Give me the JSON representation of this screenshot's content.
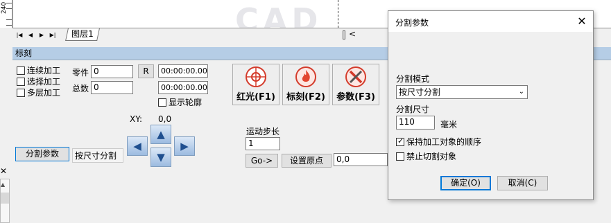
{
  "canvas": {
    "ruler_label": "240",
    "watermark": "CAD",
    "layer_tab": "图层1",
    "scroll_left_glyph": "<"
  },
  "tab_nav": [
    "|◀",
    "◀",
    "▶",
    "▶|"
  ],
  "left_edge": {
    "close_glyph": "✕"
  },
  "panel": {
    "title": "标刻",
    "continuous": {
      "label": "连续加工",
      "checked": false
    },
    "select_process": {
      "label": "选择加工",
      "checked": false
    },
    "multilayer": {
      "label": "多层加工",
      "checked": false
    },
    "part_label": "零件",
    "part_value": "0",
    "total_label": "总数",
    "total_value": "0",
    "reset_label": "R",
    "time1": "00:00:00.000",
    "time2": "00:00:00.000",
    "show_outline": {
      "label": "显示轮廓",
      "checked": false
    },
    "red_light_label": "红光(F1)",
    "mark_label": "标刻(F2)",
    "params_label": "参数(F3)",
    "split_params_button": "分割参数",
    "split_mode_value": "按尺寸分割",
    "xy_label": "XY:",
    "xy_value": "0,0",
    "step_label": "运动步长",
    "step_value": "1",
    "goto_label": "Go->",
    "set_origin_label": "设置原点",
    "origin_value": "0,0"
  },
  "dialog": {
    "title": "分割参数",
    "close_glyph": "✕",
    "mode_label": "分割模式",
    "mode_value": "按尺寸分割",
    "size_label": "分割尺寸",
    "size_value": "110",
    "size_unit": "毫米",
    "keep_order": {
      "label": "保持加工对象的顺序",
      "checked": true
    },
    "no_cut": {
      "label": "禁止切割对象",
      "checked": false
    },
    "ok_label": "确定(O)",
    "cancel_label": "取消(C)"
  },
  "icons": {
    "red_light": "crosshair-target-icon",
    "mark": "flame-icon",
    "params": "crossed-tools-icon"
  },
  "colors": {
    "panel_header": "#b5cde6",
    "primary_button_border": "#0078d7",
    "arrow_fill": "#9cbbe0"
  }
}
